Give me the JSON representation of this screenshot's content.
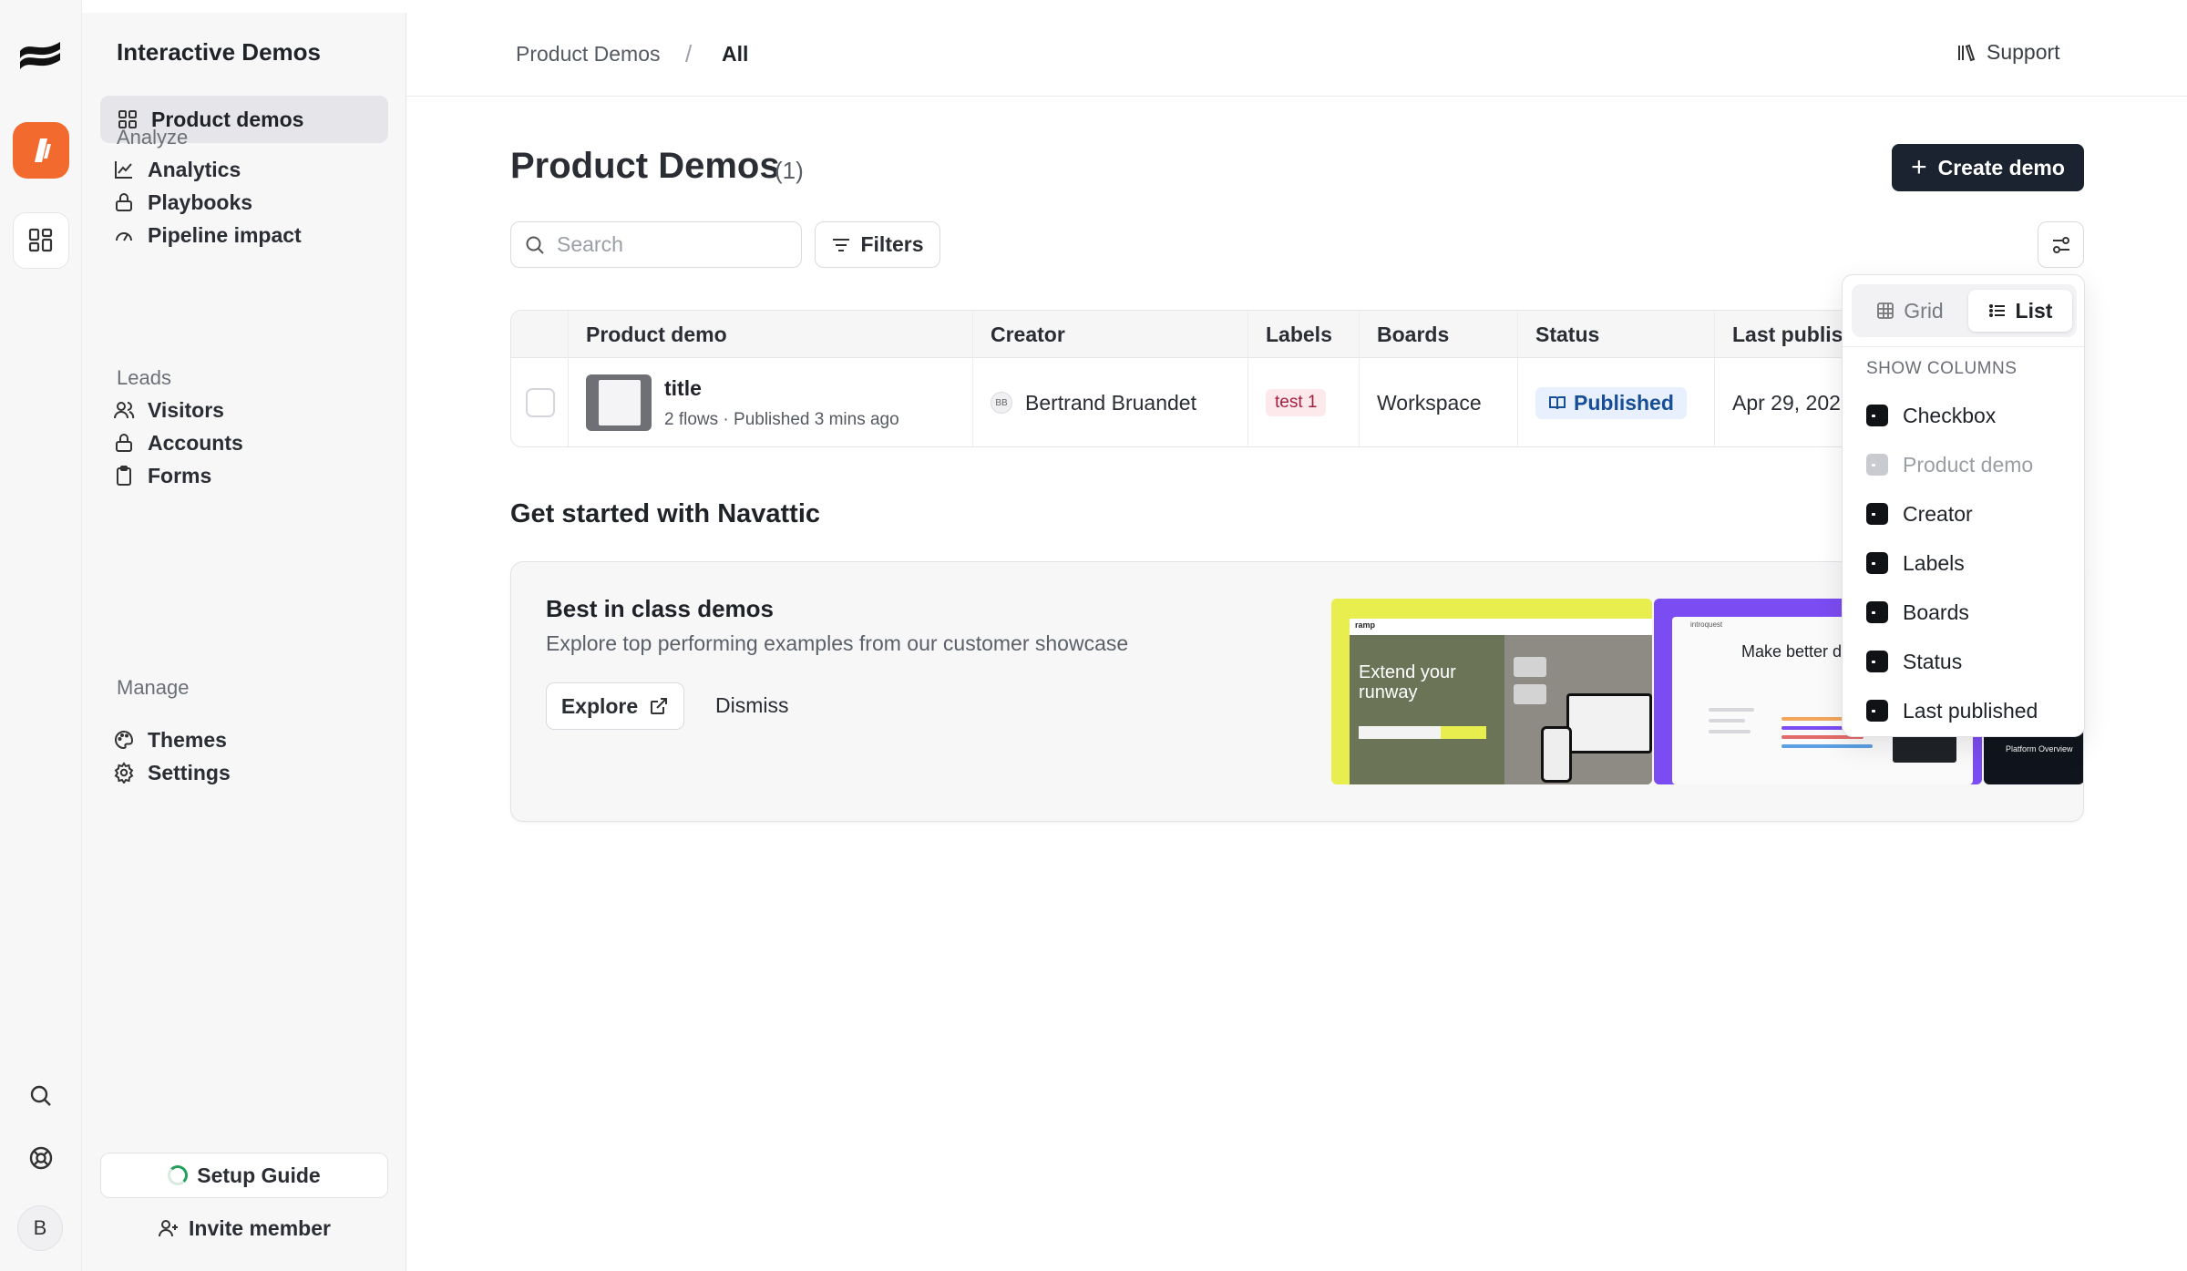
{
  "workspace": {
    "title": "Interactive Demos"
  },
  "rail": {
    "icons": [
      "navattic-logo-icon",
      "product-app-icon",
      "grid-apps-icon",
      "search-icon",
      "help-lifebuoy-icon"
    ],
    "avatar_initial": "B"
  },
  "sidebar": {
    "active_item": "Product demos",
    "sections": [
      {
        "heading": "Analyze",
        "items": [
          "Analytics",
          "Playbooks",
          "Pipeline impact"
        ]
      },
      {
        "heading": "Leads",
        "items": [
          "Visitors",
          "Accounts",
          "Forms"
        ]
      },
      {
        "heading": "Manage",
        "items": [
          "Themes",
          "Settings"
        ]
      }
    ],
    "setup_guide": "Setup Guide",
    "invite_member": "Invite member"
  },
  "breadcrumb": {
    "root": "Product Demos",
    "separator": "/",
    "current": "All"
  },
  "support": "Support",
  "page": {
    "title": "Product Demos",
    "count": "(1)",
    "create_label": "Create demo"
  },
  "toolbar": {
    "search_placeholder": "Search",
    "filters_label": "Filters"
  },
  "table": {
    "columns": [
      "Product demo",
      "Creator",
      "Labels",
      "Boards",
      "Status",
      "Last publis"
    ],
    "rows": [
      {
        "title": "title",
        "meta": "2 flows · Published 3 mins ago",
        "creator_initials": "BB",
        "creator": "Bertrand Bruandet",
        "label": "test 1",
        "board": "Workspace",
        "status": "Published",
        "last_published": "Apr 29, 202"
      }
    ]
  },
  "get_started": {
    "heading": "Get started with Navattic",
    "card_title": "Best in class demos",
    "card_subtitle": "Explore top performing examples from our customer showcase",
    "explore_label": "Explore",
    "dismiss_label": "Dismiss",
    "shot1": {
      "brand": "ramp",
      "headline": "Extend your runway"
    },
    "shot2": {
      "brand": "introquest",
      "headline": "Make better de"
    },
    "shot3": {
      "caption": "Platform Overview"
    }
  },
  "view_menu": {
    "grid_label": "Grid",
    "list_label": "List",
    "selected_view": "List",
    "columns_heading": "SHOW COLUMNS",
    "columns": [
      {
        "label": "Checkbox",
        "checked": true,
        "disabled": false
      },
      {
        "label": "Product demo",
        "checked": true,
        "disabled": true
      },
      {
        "label": "Creator",
        "checked": true,
        "disabled": false
      },
      {
        "label": "Labels",
        "checked": true,
        "disabled": false
      },
      {
        "label": "Boards",
        "checked": true,
        "disabled": false
      },
      {
        "label": "Status",
        "checked": true,
        "disabled": false
      },
      {
        "label": "Last published",
        "checked": true,
        "disabled": false
      }
    ]
  },
  "colors": {
    "accent_dark": "#1b2330",
    "app_orange": "#f26a2e",
    "status_blue": "#174e96",
    "label_pink": "#fde8ec"
  }
}
